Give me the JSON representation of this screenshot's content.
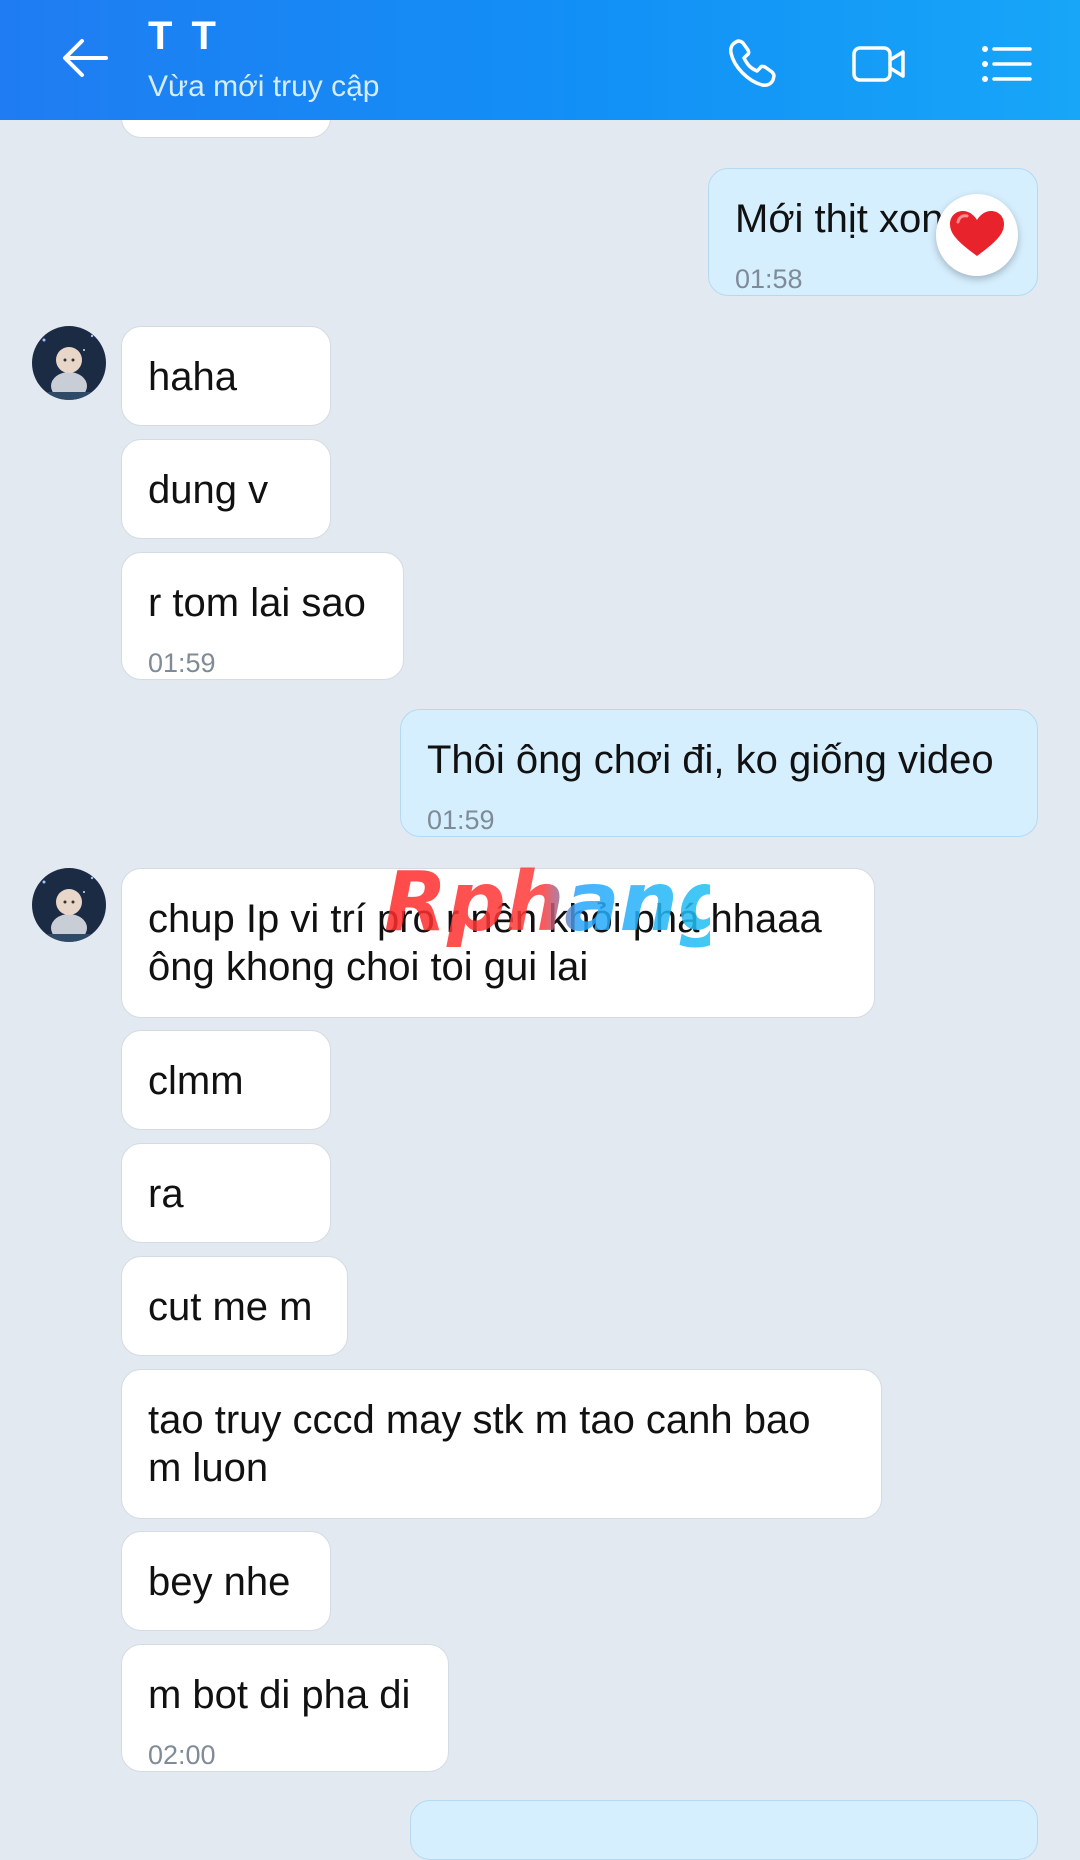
{
  "header": {
    "title": "T T",
    "status": "Vừa mới truy cập"
  },
  "messages": [
    {
      "id": "m1",
      "dir": "out",
      "text": "Mới thịt xong à",
      "time": "01:58",
      "reaction": "heart"
    },
    {
      "id": "m2",
      "dir": "in",
      "text": "haha"
    },
    {
      "id": "m3",
      "dir": "in",
      "text": "dung v"
    },
    {
      "id": "m4",
      "dir": "in",
      "text": "r tom lai sao",
      "time": "01:59"
    },
    {
      "id": "m5",
      "dir": "out",
      "text": "Thôi ông chơi đi, ko giống video",
      "time": "01:59"
    },
    {
      "id": "m6",
      "dir": "in",
      "line1": "chup Ip vi trí pro r nên khỏi phá hhaaa",
      "line2": "ông khong choi toi gui lai"
    },
    {
      "id": "m7",
      "dir": "in",
      "text": "clmm"
    },
    {
      "id": "m8",
      "dir": "in",
      "text": "ra"
    },
    {
      "id": "m9",
      "dir": "in",
      "text": "cut me m"
    },
    {
      "id": "m10",
      "dir": "in",
      "line1": "tao truy cccd may stk m tao canh bao",
      "line2": "m luon"
    },
    {
      "id": "m11",
      "dir": "in",
      "text": "bey nhe"
    },
    {
      "id": "m12",
      "dir": "in",
      "text": "m bot di pha di",
      "time": "02:00"
    }
  ],
  "watermark": "Rphang",
  "colors": {
    "header_start": "#1f7cf2",
    "header_end": "#17a6f8",
    "background": "#e2e9f1",
    "incoming_bubble": "#ffffff",
    "outgoing_bubble": "#d6efff",
    "timestamp": "#7f8b97"
  },
  "icons": {
    "back": "arrow-left-icon",
    "call": "phone-icon",
    "video": "video-camera-icon",
    "menu": "list-menu-icon",
    "reaction": "heart-icon"
  }
}
